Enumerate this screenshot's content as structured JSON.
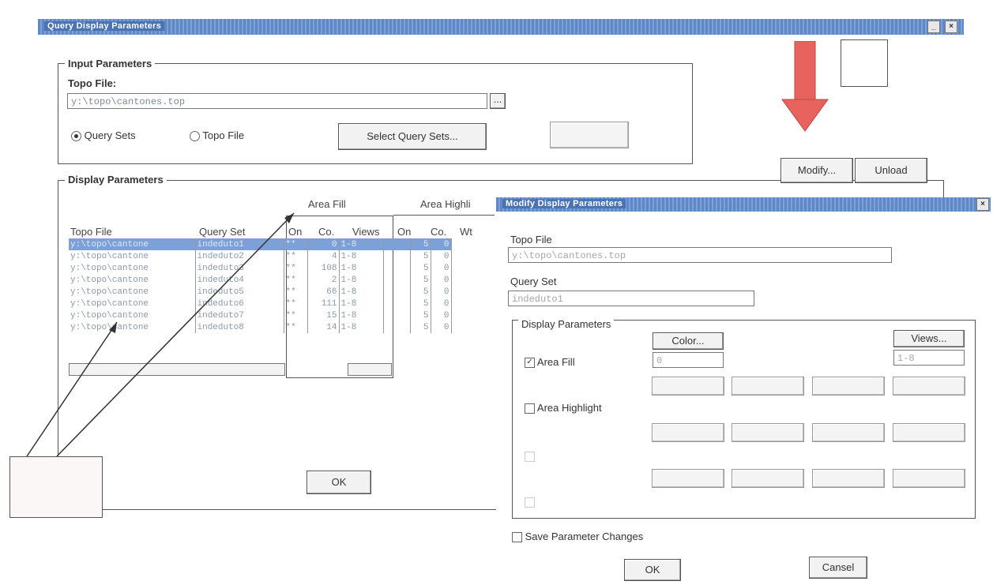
{
  "main_window": {
    "title": "Query Display Parameters",
    "minimize_glyph": "_",
    "close_glyph": "×"
  },
  "input_params": {
    "group_label": "Input Parameters",
    "topo_file_label": "Topo File:",
    "topo_file_value": "y:\\topo\\cantones.top",
    "browse_label": "...",
    "radio_query_sets": "Query Sets",
    "radio_topo_file": "Topo File",
    "select_query_sets": "Select Query Sets..."
  },
  "display_params": {
    "group_label": "Display Parameters",
    "modify_button": "Modify...",
    "unload_button": "Unload",
    "ok_button": "OK",
    "columns": {
      "topo_file": "Topo File",
      "query_set": "Query Set",
      "area_fill": "Area Fill",
      "area_highlight": "Area Highli",
      "on": "On",
      "co": "Co.",
      "views": "Views",
      "on2": "On",
      "co2": "Co.",
      "wt": "Wt"
    },
    "rows": [
      {
        "topo": "y:\\topo\\cantone",
        "query": "indeduto1",
        "on": "**",
        "co": "0",
        "views": "1-8",
        "hco": "5",
        "wt": "0"
      },
      {
        "topo": "y:\\topo\\cantone",
        "query": "indeduto2",
        "on": "**",
        "co": "4",
        "views": "1-8",
        "hco": "5",
        "wt": "0"
      },
      {
        "topo": "y:\\topo\\cantone",
        "query": "indeduto3",
        "on": "**",
        "co": "108",
        "views": "1-8",
        "hco": "5",
        "wt": "0"
      },
      {
        "topo": "y:\\topo\\cantone",
        "query": "indeduto4",
        "on": "**",
        "co": "2",
        "views": "1-8",
        "hco": "5",
        "wt": "0"
      },
      {
        "topo": "y:\\topo\\cantone",
        "query": "indeduto5",
        "on": "**",
        "co": "66",
        "views": "1-8",
        "hco": "5",
        "wt": "0"
      },
      {
        "topo": "y:\\topo\\cantone",
        "query": "indeduto6",
        "on": "**",
        "co": "111",
        "views": "1-8",
        "hco": "5",
        "wt": "0"
      },
      {
        "topo": "y:\\topo\\cantone",
        "query": "indeduto7",
        "on": "**",
        "co": "15",
        "views": "1-8",
        "hco": "5",
        "wt": "0"
      },
      {
        "topo": "y:\\topo\\cantone",
        "query": "indeduto8",
        "on": "**",
        "co": "14",
        "views": "1-8",
        "hco": "5",
        "wt": "0"
      }
    ]
  },
  "modify_dialog": {
    "title": "Modify Display Parameters",
    "close_glyph": "×",
    "topo_file_label": "Topo File",
    "topo_file_value": "y:\\topo\\cantones.top",
    "query_set_label": "Query Set",
    "query_set_value": "indeduto1",
    "group_label": "Display Parameters",
    "color_button": "Color...",
    "views_button": "Views...",
    "area_fill_label": "Area Fill",
    "area_fill_color_value": "0",
    "area_fill_views_value": "1-8",
    "area_highlight_label": "Area Highlight",
    "save_changes_label": "Save Parameter Changes",
    "ok_button": "OK",
    "cancel_button": "Cansel"
  },
  "colors": {
    "titlebar": "#5f88c6",
    "selection": "#7da1d6",
    "arrow": "#e8625e"
  }
}
